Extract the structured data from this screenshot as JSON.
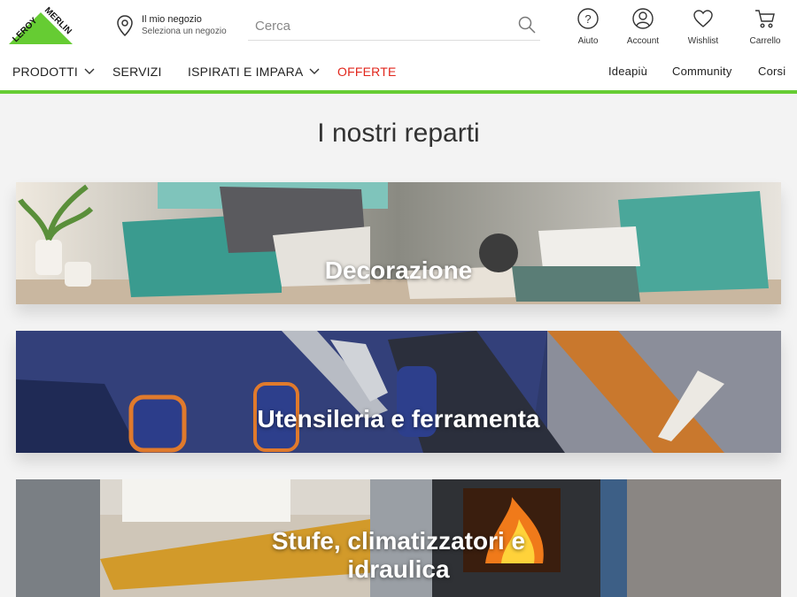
{
  "brand": {
    "logo_text_top": "LEROY",
    "logo_text_bottom": "MERLIN",
    "colors": {
      "green": "#66cc33",
      "offers_red": "#e1261c",
      "dark": "#222222"
    }
  },
  "header": {
    "store": {
      "title": "Il mio negozio",
      "subtitle": "Seleziona un negozio",
      "icon": "location-pin-icon"
    },
    "search": {
      "placeholder": "Cerca",
      "icon": "search-icon"
    },
    "icons": [
      {
        "label": "Aiuto",
        "icon": "help-icon"
      },
      {
        "label": "Account",
        "icon": "account-icon"
      },
      {
        "label": "Wishlist",
        "icon": "heart-icon"
      },
      {
        "label": "Carrello",
        "icon": "cart-icon"
      }
    ]
  },
  "nav": {
    "left": [
      {
        "label": "PRODOTTI",
        "has_dropdown": true
      },
      {
        "label": "SERVIZI",
        "has_dropdown": false
      },
      {
        "label": "ISPIRATI E IMPARA",
        "has_dropdown": true
      },
      {
        "label": "OFFERTE",
        "has_dropdown": false
      }
    ],
    "right": [
      {
        "label": "Ideapiù"
      },
      {
        "label": "Community"
      },
      {
        "label": "Corsi"
      }
    ]
  },
  "main": {
    "title": "I nostri reparti",
    "departments": [
      {
        "label": "Decorazione"
      },
      {
        "label": "Utensileria e ferramenta"
      },
      {
        "label_line1": "Stufe, climatizzatori e",
        "label_line2": "idraulica"
      }
    ]
  }
}
